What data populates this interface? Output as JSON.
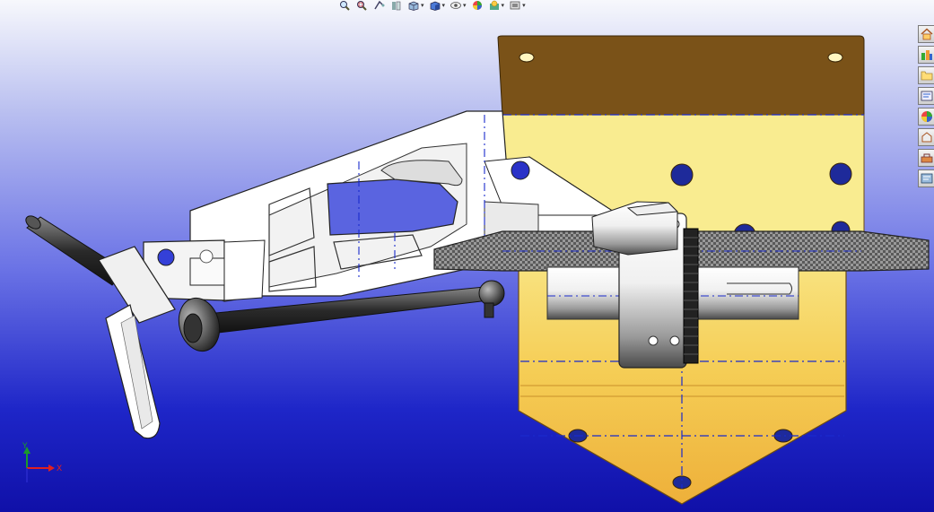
{
  "toolbar": {
    "items": [
      {
        "icon": "zoom-to-fit-icon",
        "dropdown": false
      },
      {
        "icon": "zoom-to-area-icon",
        "dropdown": false
      },
      {
        "icon": "previous-view-icon",
        "dropdown": false
      },
      {
        "icon": "section-view-icon",
        "dropdown": false
      },
      {
        "icon": "view-orientation-icon",
        "dropdown": true
      },
      {
        "icon": "display-style-icon",
        "dropdown": true
      },
      {
        "icon": "hide-show-items-icon",
        "dropdown": true
      },
      {
        "icon": "edit-appearance-icon",
        "dropdown": false
      },
      {
        "icon": "apply-scene-icon",
        "dropdown": true
      },
      {
        "icon": "view-settings-icon",
        "dropdown": true
      }
    ]
  },
  "taskpane": {
    "buttons": [
      {
        "icon": "home-icon"
      },
      {
        "icon": "design-library-icon"
      },
      {
        "icon": "file-explorer-icon"
      },
      {
        "icon": "view-palette-icon"
      },
      {
        "icon": "appearances-icon"
      },
      {
        "icon": "custom-properties-icon"
      },
      {
        "icon": "toolbox-icon"
      },
      {
        "icon": "forum-icon"
      }
    ]
  },
  "triad": {
    "x_label": "X",
    "y_label": "Y",
    "colors": {
      "x": "#e02020",
      "y": "#1a9a2a",
      "z": "#2a2acc"
    }
  },
  "colors": {
    "plate": "#f2c04a",
    "plate_dark": "#7a5218",
    "plate_light": "#f9e88a",
    "carbon": "#555555",
    "part_light": "#ffffff",
    "part_dark": "#3a3a3a",
    "centerline": "#1a2acc"
  }
}
